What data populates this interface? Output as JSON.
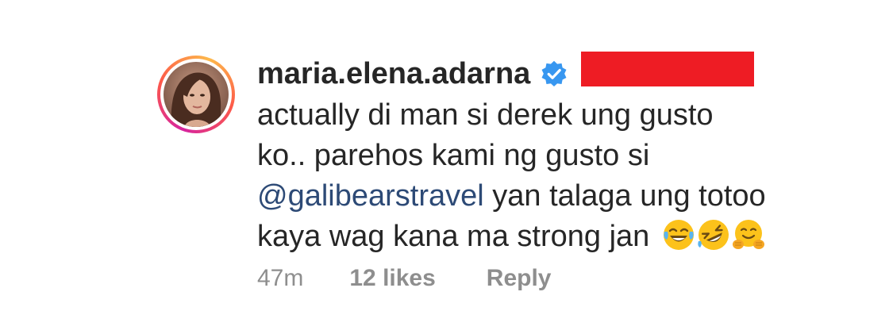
{
  "comment": {
    "username": "maria.elena.adarna",
    "verified": true,
    "verified_icon": "verified-badge-icon",
    "verified_color": "#3897f0",
    "redaction_color": "#ee1c24",
    "text_before_mention_line1": "actually di man si derek ung gusto",
    "text_before_mention_line2": "ko.. parehos kami ng gusto si",
    "mention": "@galibearstravel",
    "text_after_mention": " yan talaga ung totoo kaya wag kana ma strong jan ",
    "emojis": [
      "face-with-tears-of-joy-icon",
      "rolling-on-the-floor-laughing-icon",
      "hugging-face-icon"
    ],
    "mention_color": "#2d4a76"
  },
  "footer": {
    "time": "47m",
    "likes": "12 likes",
    "reply": "Reply"
  }
}
